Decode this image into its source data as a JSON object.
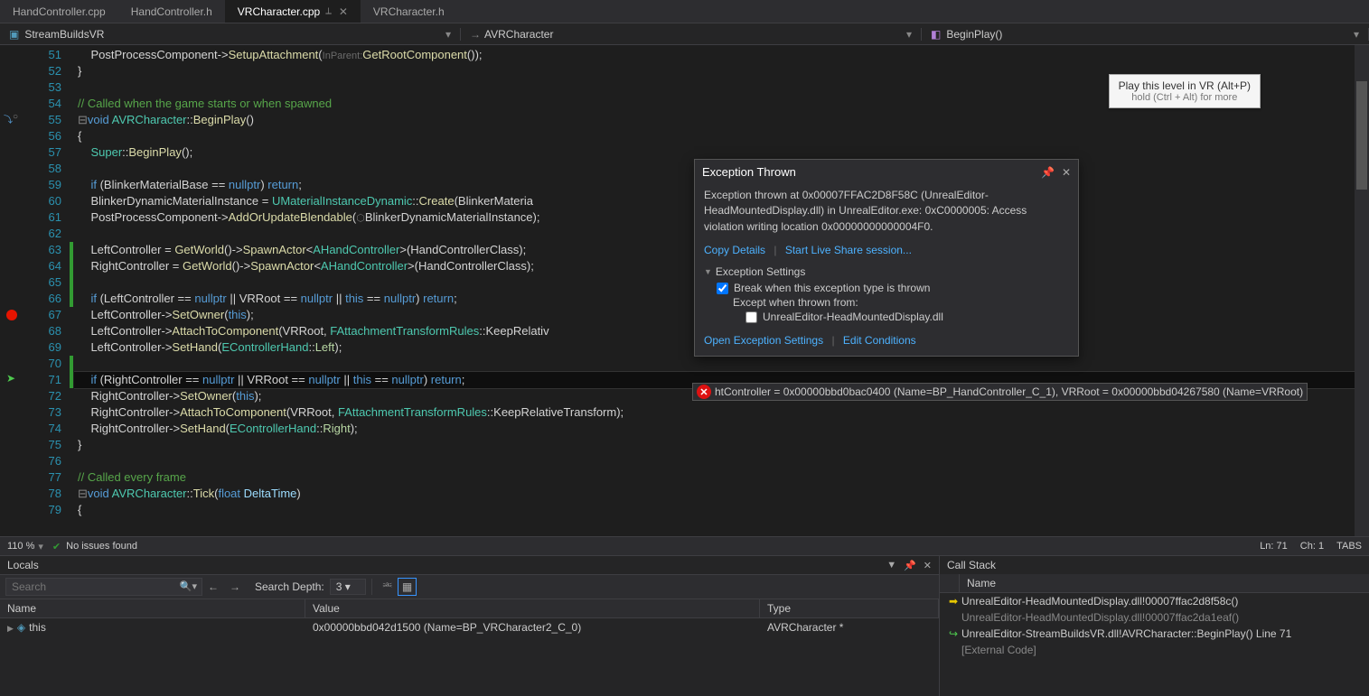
{
  "tabs": [
    {
      "label": "HandController.cpp",
      "active": false
    },
    {
      "label": "HandController.h",
      "active": false
    },
    {
      "label": "VRCharacter.cpp",
      "active": true,
      "pinned": true
    },
    {
      "label": "VRCharacter.h",
      "active": false
    }
  ],
  "nav": {
    "project": "StreamBuildsVR",
    "class": "AVRCharacter",
    "member": "BeginPlay()"
  },
  "tooltip": {
    "title": "Play this level in VR (Alt+P)",
    "sub": "hold (Ctrl + Alt) for more"
  },
  "code_lines": [
    {
      "n": 51,
      "html": "    PostProcessComponent-><span class='c-func'>SetupAttachment</span>(<span class='c-hint'>InParent:</span><span class='c-func'>GetRootComponent</span>());"
    },
    {
      "n": 52,
      "html": "}"
    },
    {
      "n": 53,
      "html": ""
    },
    {
      "n": 54,
      "html": "<span class='c-comment'>// Called when the game starts or when spawned</span>"
    },
    {
      "n": 55,
      "html": "<span class='fold'>⊟</span><span class='c-kw'>void</span> <span class='c-type'>AVRCharacter</span>::<span class='c-func'>BeginPlay</span>()",
      "margin": "arc"
    },
    {
      "n": 56,
      "html": "{"
    },
    {
      "n": 57,
      "html": "    <span class='c-type'>Super</span>::<span class='c-func'>BeginPlay</span>();"
    },
    {
      "n": 58,
      "html": ""
    },
    {
      "n": 59,
      "html": "    <span class='c-kw'>if</span> (BlinkerMaterialBase == <span class='c-kw'>nullptr</span>) <span class='c-kw'>return</span>;"
    },
    {
      "n": 60,
      "html": "    BlinkerDynamicMaterialInstance = <span class='c-type'>UMaterialInstanceDynamic</span>::<span class='c-func'>Create</span>(BlinkerMateria"
    },
    {
      "n": 61,
      "html": "    PostProcessComponent-><span class='c-func'>AddOrUpdateBlendable</span>(<span class='c-hint'>⬡</span>BlinkerDynamicMaterialInstance);"
    },
    {
      "n": 62,
      "html": ""
    },
    {
      "n": 63,
      "html": "    LeftController = <span class='c-func'>GetWorld</span>()-><span class='c-func'>SpawnActor</span>&lt;<span class='c-type'>AHandController</span>&gt;(HandControllerClass);",
      "change": "green"
    },
    {
      "n": 64,
      "html": "    RightController = <span class='c-func'>GetWorld</span>()-><span class='c-func'>SpawnActor</span>&lt;<span class='c-type'>AHandController</span>&gt;(HandControllerClass);",
      "change": "green"
    },
    {
      "n": 65,
      "html": "",
      "change": "green"
    },
    {
      "n": 66,
      "html": "    <span class='c-kw'>if</span> (LeftController == <span class='c-kw'>nullptr</span> || VRRoot == <span class='c-kw'>nullptr</span> || <span class='c-kw'>this</span> == <span class='c-kw'>nullptr</span>) <span class='c-kw'>return</span>;",
      "change": "green"
    },
    {
      "n": 67,
      "html": "    LeftController-><span class='c-func'>SetOwner</span>(<span class='c-kw'>this</span>);",
      "bp": true
    },
    {
      "n": 68,
      "html": "    LeftController-><span class='c-func'>AttachToComponent</span>(VRRoot, <span class='c-type'>FAttachmentTransformRules</span>::KeepRelativ"
    },
    {
      "n": 69,
      "html": "    LeftController-><span class='c-func'>SetHand</span>(<span class='c-type'>EControllerHand</span>::<span class='c-enum'>Left</span>);"
    },
    {
      "n": 70,
      "html": "",
      "change": "green"
    },
    {
      "n": 71,
      "html": "    <span class='c-kw'>if</span> (RightController == <span class='c-kw'>nullptr</span> || VRRoot == <span class='c-kw'>nullptr</span> || <span class='c-kw'>this</span> == <span class='c-kw'>nullptr</span>) <span class='c-kw'>return</span>;",
      "change": "green",
      "current": true,
      "arrow": true
    },
    {
      "n": 72,
      "html": "    RightController-><span class='c-func'>SetOwner</span>(<span class='c-kw'>this</span>);"
    },
    {
      "n": 73,
      "html": "    RightController-><span class='c-func'>AttachToComponent</span>(VRRoot, <span class='c-type'>FAttachmentTransformRules</span>::KeepRelativeTransform);"
    },
    {
      "n": 74,
      "html": "    RightController-><span class='c-func'>SetHand</span>(<span class='c-type'>EControllerHand</span>::<span class='c-enum'>Right</span>);"
    },
    {
      "n": 75,
      "html": "}"
    },
    {
      "n": 76,
      "html": ""
    },
    {
      "n": 77,
      "html": "<span class='c-comment'>// Called every frame</span>"
    },
    {
      "n": 78,
      "html": "<span class='fold'>⊟</span><span class='c-kw'>void</span> <span class='c-type'>AVRCharacter</span>::<span class='c-func'>Tick</span>(<span class='c-kw'>float</span> <span class='c-param'>DeltaTime</span>)"
    },
    {
      "n": 79,
      "html": "{"
    }
  ],
  "datatip": "htController = 0x00000bbd0bac0400 (Name=BP_HandController_C_1),  VRRoot = 0x00000bbd04267580 (Name=VRRoot)",
  "exception": {
    "title": "Exception Thrown",
    "body": "Exception thrown at 0x00007FFAC2D8F58C (UnrealEditor-HeadMountedDisplay.dll) in UnrealEditor.exe: 0xC0000005: Access violation writing location 0x00000000000004F0.",
    "link_copy": "Copy Details",
    "link_share": "Start Live Share session...",
    "settings_hdr": "Exception Settings",
    "chk1_label": "Break when this exception type is thrown",
    "chk1": true,
    "sub_label": "Except when thrown from:",
    "chk2_label": "UnrealEditor-HeadMountedDisplay.dll",
    "chk2": false,
    "link_open": "Open Exception Settings",
    "link_edit": "Edit Conditions"
  },
  "status": {
    "zoom": "110 %",
    "issues": "No issues found",
    "ln": "Ln: 71",
    "ch": "Ch: 1",
    "tabs": "TABS"
  },
  "locals": {
    "title": "Locals",
    "search_placeholder": "Search",
    "depth_label": "Search Depth:",
    "depth_value": "3",
    "cols": {
      "name": "Name",
      "value": "Value",
      "type": "Type"
    },
    "rows": [
      {
        "name": "this",
        "value": "0x00000bbd042d1500 (Name=BP_VRCharacter2_C_0)",
        "type": "AVRCharacter *"
      }
    ]
  },
  "callstack": {
    "title": "Call Stack",
    "col": "Name",
    "rows": [
      {
        "mk": "y",
        "text": "UnrealEditor-HeadMountedDisplay.dll!00007ffac2d8f58c()"
      },
      {
        "mk": "",
        "dim": true,
        "text": "UnrealEditor-HeadMountedDisplay.dll!00007ffac2da1eaf()"
      },
      {
        "mk": "g",
        "text": "UnrealEditor-StreamBuildsVR.dll!AVRCharacter::BeginPlay() Line 71"
      },
      {
        "mk": "",
        "dim": true,
        "text": "[External Code]"
      }
    ]
  }
}
